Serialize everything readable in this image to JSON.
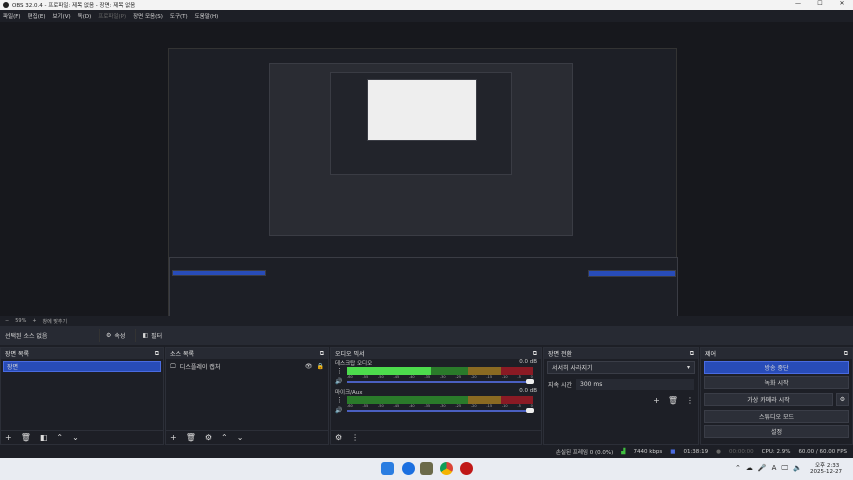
{
  "window": {
    "title": "OBS 32.0.4 - 프로파일: 제목 없음 - 장면: 제목 없음",
    "minimize": "—",
    "maximize": "☐",
    "close": "✕"
  },
  "menu": [
    "파일(F)",
    "편집(E)",
    "보기(V)",
    "독(D)",
    "프로파일(P)",
    "장면 모음(S)",
    "도구(T)",
    "도움말(H)"
  ],
  "zoom": {
    "minus": "−",
    "value": "59%",
    "plus": "+",
    "fit": "창에 맞추기"
  },
  "source_toolbar": {
    "label": "선택된 소스 없음",
    "properties": "속성",
    "filters": "필터"
  },
  "scenes": {
    "title": "장면 목록",
    "items": [
      "장면"
    ]
  },
  "sources": {
    "title": "소스 목록",
    "items": [
      "디스플레이 캡처"
    ]
  },
  "mixer": {
    "title": "오디오 믹서",
    "channels": [
      {
        "name": "데스크탑 오디오",
        "db": "0.0 dB",
        "level": 0.5
      },
      {
        "name": "마이크/Aux",
        "db": "0.0 dB",
        "level": 0
      }
    ],
    "ticks": [
      "-60",
      "-55",
      "-50",
      "-45",
      "-40",
      "-35",
      "-30",
      "-25",
      "-20",
      "-15",
      "-10",
      "-5",
      "0"
    ]
  },
  "transitions": {
    "title": "장면 전환",
    "selected": "서서히 사라지기",
    "duration_label": "지속 시간",
    "duration": "300 ms"
  },
  "controls": {
    "title": "제어",
    "buttons": [
      "방송 중단",
      "녹화 시작",
      "가상 카메라 시작",
      "스튜디오 모드",
      "설정"
    ]
  },
  "status": {
    "dropped": "손실된 프레임 0 (0.0%)",
    "bitrate": "7440 kbps",
    "stream_time": "01:38:19",
    "rec_time": "00:00:00",
    "cpu": "CPU: 2.9%",
    "fps": "60.00 / 60.00 FPS"
  },
  "taskbar": {
    "time": "오후 2:33",
    "date": "2025-12-27"
  },
  "colors": {
    "accent": "#284cb8",
    "green": "#3fbf3f",
    "yellow": "#b8862a",
    "red": "#a0202a"
  }
}
